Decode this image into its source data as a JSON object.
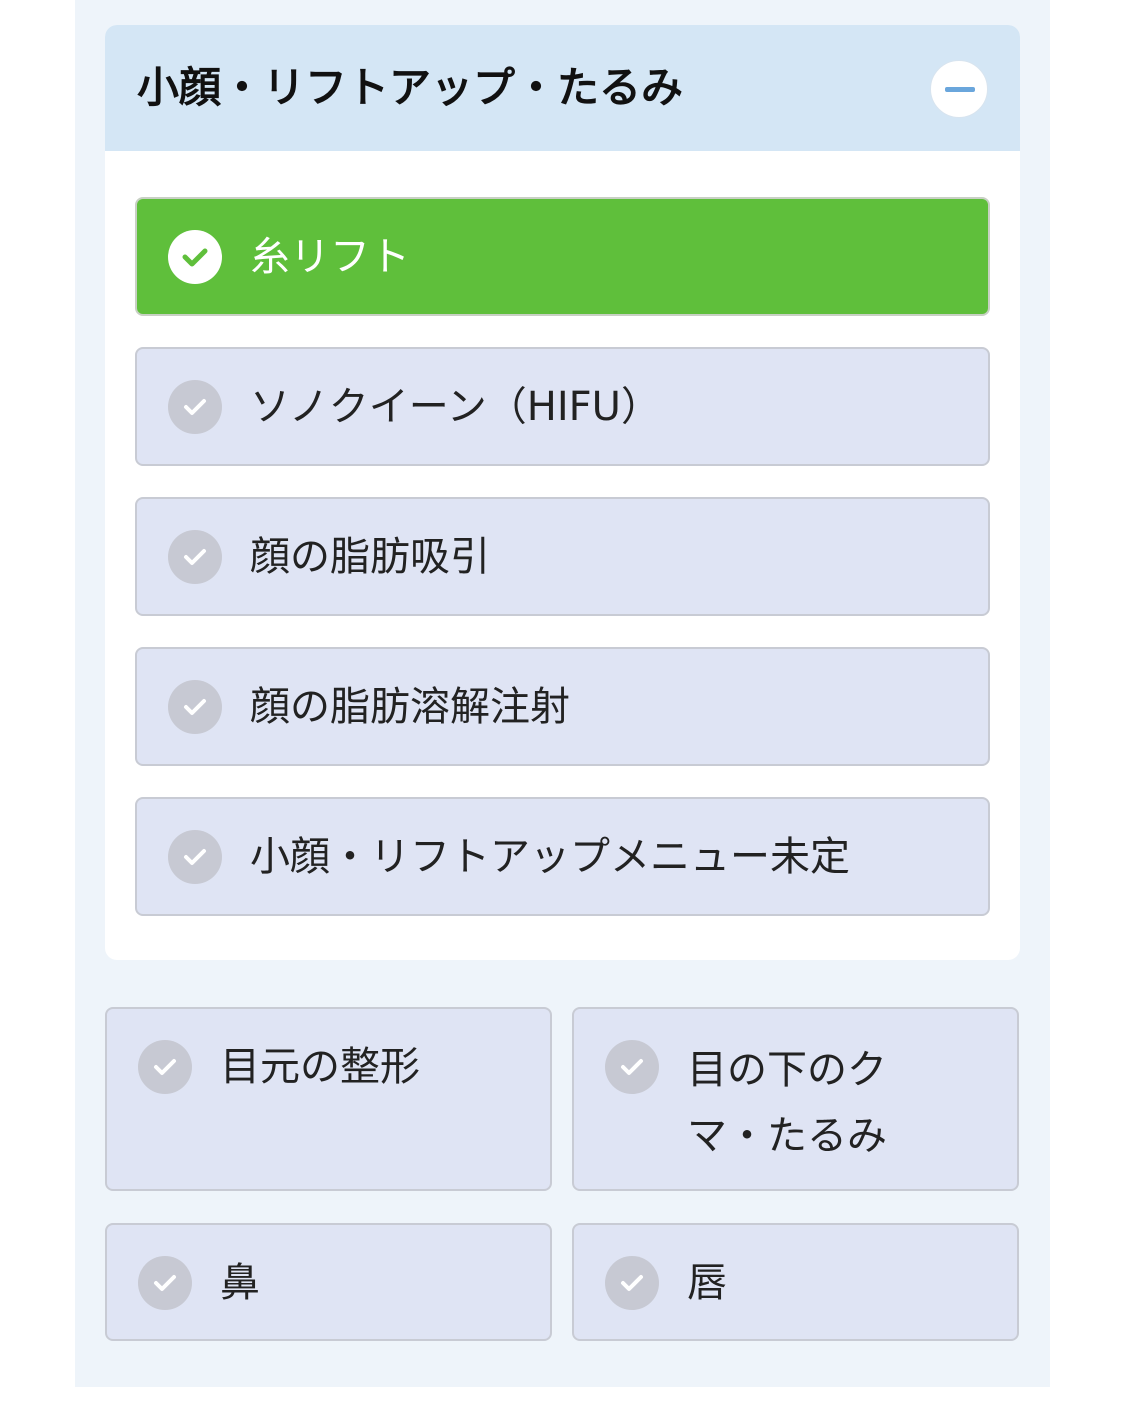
{
  "section": {
    "title": "小顔・リフトアップ・たるみ",
    "collapse_icon": "minus-icon",
    "accent_color": "#6aa6dc",
    "header_bg": "#d4e6f5"
  },
  "options": [
    {
      "label": "糸リフト",
      "selected": true
    },
    {
      "label": "ソノクイーン（HIFU）",
      "selected": false
    },
    {
      "label": "顔の脂肪吸引",
      "selected": false
    },
    {
      "label": "顔の脂肪溶解注射",
      "selected": false
    },
    {
      "label": "小顔・リフトアップメニュー未定",
      "selected": false
    }
  ],
  "categories": [
    {
      "label": "目元の整形",
      "selected": false
    },
    {
      "label": "目の下のクマ・たるみ",
      "selected": false
    },
    {
      "label": "鼻",
      "selected": false
    },
    {
      "label": "唇",
      "selected": false
    }
  ],
  "colors": {
    "selected_bg": "#5fbf3b",
    "unselected_bg": "#dfe4f4",
    "check_unselected": "#c7c9d3",
    "panel_bg": "#eef4fa"
  },
  "icons": {
    "check": "check-circle-icon"
  }
}
